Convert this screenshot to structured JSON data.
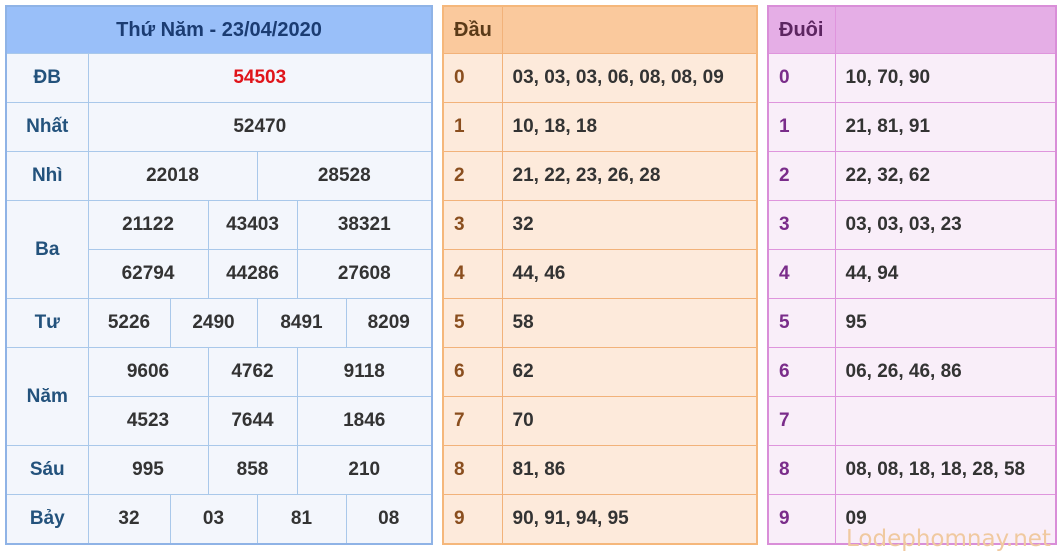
{
  "results": {
    "title": "Thứ Năm - 23/04/2020",
    "db_label": "ĐB",
    "db": "54503",
    "nhat_label": "Nhất",
    "nhat": "52470",
    "nhi_label": "Nhì",
    "nhi": [
      "22018",
      "28528"
    ],
    "ba_label": "Ba",
    "ba": [
      "21122",
      "43403",
      "38321",
      "62794",
      "44286",
      "27608"
    ],
    "tu_label": "Tư",
    "tu": [
      "5226",
      "2490",
      "8491",
      "8209"
    ],
    "nam_label": "Năm",
    "nam": [
      "9606",
      "4762",
      "9118",
      "4523",
      "7644",
      "1846"
    ],
    "sau_label": "Sáu",
    "sau": [
      "995",
      "858",
      "210"
    ],
    "bay_label": "Bảy",
    "bay": [
      "32",
      "03",
      "81",
      "08"
    ]
  },
  "dau": {
    "header": "Đầu",
    "rows": [
      {
        "key": "0",
        "val": "03, 03, 03, 06, 08, 08, 09"
      },
      {
        "key": "1",
        "val": "10, 18, 18"
      },
      {
        "key": "2",
        "val": "21, 22, 23, 26, 28"
      },
      {
        "key": "3",
        "val": "32"
      },
      {
        "key": "4",
        "val": "44, 46"
      },
      {
        "key": "5",
        "val": "58"
      },
      {
        "key": "6",
        "val": "62"
      },
      {
        "key": "7",
        "val": "70"
      },
      {
        "key": "8",
        "val": "81, 86"
      },
      {
        "key": "9",
        "val": "90, 91, 94, 95"
      }
    ]
  },
  "duoi": {
    "header": "Đuôi",
    "rows": [
      {
        "key": "0",
        "val": "10, 70, 90"
      },
      {
        "key": "1",
        "val": "21, 81, 91"
      },
      {
        "key": "2",
        "val": "22, 32, 62"
      },
      {
        "key": "3",
        "val": "03, 03, 03, 23"
      },
      {
        "key": "4",
        "val": "44, 94"
      },
      {
        "key": "5",
        "val": "95"
      },
      {
        "key": "6",
        "val": "06, 26, 46, 86"
      },
      {
        "key": "7",
        "val": ""
      },
      {
        "key": "8",
        "val": "08, 08, 18, 18, 28, 58"
      },
      {
        "key": "9",
        "val": "09"
      }
    ]
  },
  "watermark": "Lodephomnay.net"
}
